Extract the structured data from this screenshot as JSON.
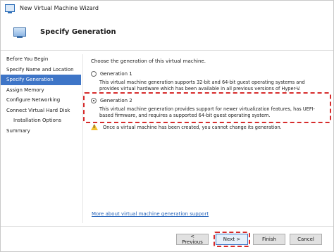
{
  "window": {
    "title": "New Virtual Machine Wizard"
  },
  "header": {
    "page_title": "Specify Generation"
  },
  "sidebar": {
    "items": [
      {
        "label": "Before You Begin",
        "active": false
      },
      {
        "label": "Specify Name and Location",
        "active": false
      },
      {
        "label": "Specify Generation",
        "active": true
      },
      {
        "label": "Assign Memory",
        "active": false
      },
      {
        "label": "Configure Networking",
        "active": false
      },
      {
        "label": "Connect Virtual Hard Disk",
        "active": false
      },
      {
        "label": "Installation Options",
        "active": false
      },
      {
        "label": "Summary",
        "active": false
      }
    ]
  },
  "main": {
    "intro": "Choose the generation of this virtual machine.",
    "gen1": {
      "label": "Generation 1",
      "selected": false,
      "description": "This virtual machine generation supports 32-bit and 64-bit guest operating systems and provides virtual hardware which has been available in all previous versions of Hyper-V."
    },
    "gen2": {
      "label": "Generation 2",
      "selected": true,
      "description": "This virtual machine generation provides support for newer virtualization features, has UEFI-based firmware, and requires a supported 64-bit guest operating system."
    },
    "warning": "Once a virtual machine has been created, you cannot change its generation.",
    "more_link": "More about virtual machine generation support"
  },
  "buttons": {
    "previous": "< Previous",
    "next": "Next >",
    "finish": "Finish",
    "cancel": "Cancel"
  },
  "colors": {
    "active_nav": "#3e75c7",
    "highlight": "#d62b2b",
    "link": "#1f5fb8"
  },
  "icons": {
    "app": "virtual-machine-icon",
    "header": "virtual-machine-icon",
    "warning": "warning-icon"
  }
}
